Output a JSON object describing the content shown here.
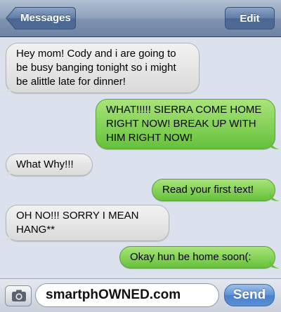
{
  "navbar": {
    "back_label": "Messages",
    "edit_label": "Edit"
  },
  "messages": [
    {
      "direction": "incoming",
      "text": "Hey mom! Cody and i are going to be busy banging tonight so i might be alittle late for dinner!"
    },
    {
      "direction": "outgoing",
      "text": "WHAT!!!!! SIERRA COME HOME RIGHT NOW! BREAK UP WITH HIM RIGHT NOW!"
    },
    {
      "direction": "incoming",
      "text": "What Why!!!"
    },
    {
      "direction": "outgoing",
      "text": "Read your first text!"
    },
    {
      "direction": "incoming",
      "text": "OH NO!!! SORRY I MEAN HANG**"
    },
    {
      "direction": "outgoing",
      "text": "Okay hun be home soon(:"
    }
  ],
  "composer": {
    "camera_icon": "camera-icon",
    "field_value": "smartphOWNED.com",
    "send_label": "Send"
  },
  "colors": {
    "incoming_bubble": "#e6e6e6",
    "outgoing_bubble": "#7fd04f",
    "background": "#dbe2ed",
    "navbar": "#8fa1bb"
  }
}
